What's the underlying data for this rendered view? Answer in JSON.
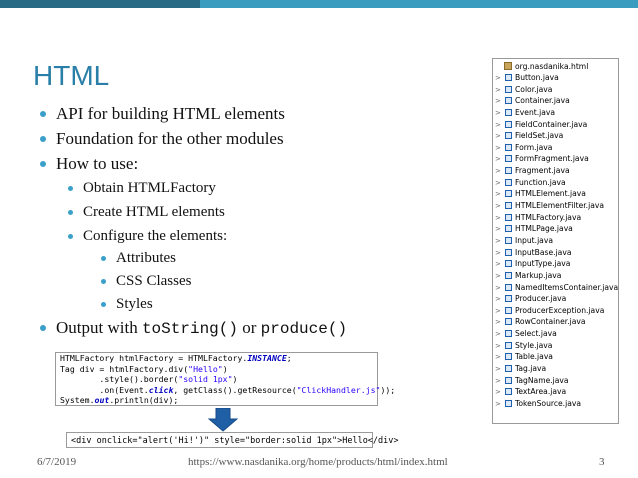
{
  "colors": {
    "accent_dark": "#276b85",
    "accent_light": "#3a9dbf",
    "bullet": "#3aa0c9",
    "title": "#2a7fa8",
    "arrow_fill": "#1f5fa5"
  },
  "slide": {
    "title": "HTML",
    "bullets": {
      "api": "API for building HTML elements",
      "foundation": "Foundation for the other modules",
      "how_to_use": "How to use:",
      "obtain": "Obtain HTMLFactory",
      "create": "Create HTML elements",
      "configure": "Configure  the elements:",
      "attributes": "Attributes",
      "css_classes": "CSS Classes",
      "styles": "Styles",
      "output_prefix": "Output with ",
      "output_tostring": "toString()",
      "output_or": " or ",
      "output_produce": "produce()"
    }
  },
  "code": {
    "line1": "HTMLFactory htmlFactory = HTMLFactory.",
    "line1_instance": "INSTANCE",
    "line1_end": ";",
    "line2a": "Tag div = htmlFactory.div(",
    "line2_str": "\"Hello\"",
    "line2_end": ")",
    "line3a": "        .style().border(",
    "line3_str": "\"solid 1px\"",
    "line3_end": ")",
    "line4a": "        .on(Event.",
    "line4_click": "click",
    "line4b": ", getClass().getResource(",
    "line4_str": "\"ClickHandler.js\"",
    "line4_end": "));",
    "line5a": "System.",
    "line5_out": "out",
    "line5b": ".println(div);"
  },
  "output": {
    "text": "<div onclick=\"alert('Hi!')\" style=\"border:solid 1px\">Hello</div>"
  },
  "tree": {
    "root": "org.nasdanika.html",
    "expand_glyph": ">",
    "files": [
      "Button.java",
      "Color.java",
      "Container.java",
      "Event.java",
      "FieldContainer.java",
      "FieldSet.java",
      "Form.java",
      "FormFragment.java",
      "Fragment.java",
      "Function.java",
      "HTMLElement.java",
      "HTMLElementFilter.java",
      "HTMLFactory.java",
      "HTMLPage.java",
      "Input.java",
      "InputBase.java",
      "InputType.java",
      "Markup.java",
      "NamedItemsContainer.java",
      "Producer.java",
      "ProducerException.java",
      "RowContainer.java",
      "Select.java",
      "Style.java",
      "Table.java",
      "Tag.java",
      "TagName.java",
      "TextArea.java",
      "TokenSource.java"
    ]
  },
  "footer": {
    "date": "6/7/2019",
    "url": "https://www.nasdanika.org/home/products/html/index.html",
    "page": "3"
  }
}
